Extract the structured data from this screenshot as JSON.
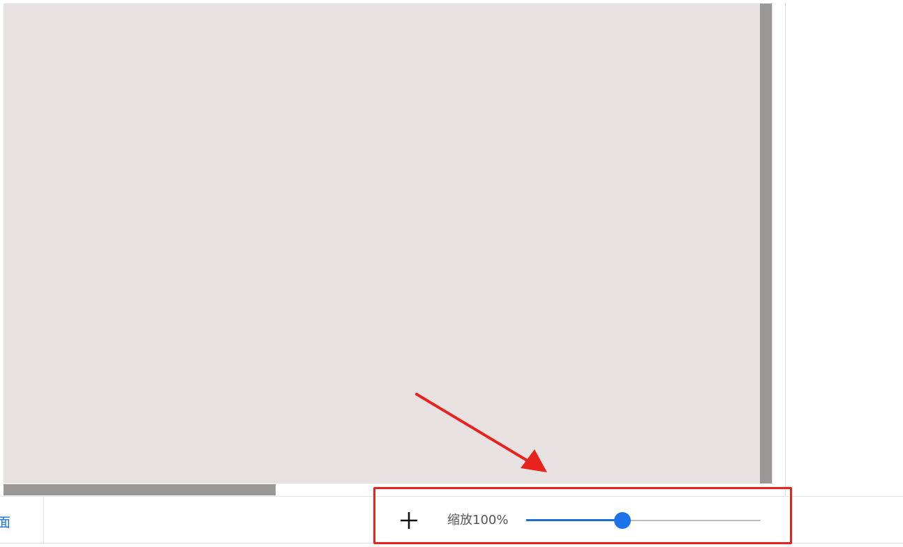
{
  "app": {
    "accent_color": "#1a73e8",
    "canvas_color": "#e7e1e1",
    "scrollbar_color": "#999896",
    "highlight_color": "#e8231d"
  },
  "bottom_bar": {
    "page_tab_label": "面",
    "zoom_in_icon": "plus-icon",
    "zoom_label": "缩放100%",
    "zoom_slider_fraction": 0.41
  },
  "annotation": {
    "type": "red-arrow-and-box",
    "points_to": "zoom-controls"
  }
}
